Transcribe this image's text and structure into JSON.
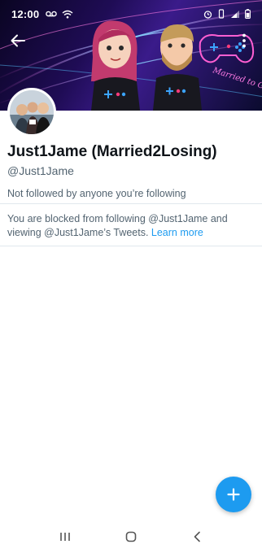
{
  "status_bar": {
    "time": "12:00",
    "left_icons": [
      "voicemail-icon",
      "wifi-icon"
    ],
    "right_icons": [
      "alarm-icon",
      "vibrate-icon",
      "signal-icon",
      "battery-icon"
    ]
  },
  "header": {
    "back_icon": "arrow-left-icon",
    "more_icon": "more-vertical-icon",
    "banner_text": "Married to Gaming"
  },
  "profile": {
    "display_name": "Just1Jame (Married2Losing)",
    "handle": "@Just1Jame",
    "followers_note": "Not followed by anyone you’re following"
  },
  "blocked_notice": {
    "text": "You are blocked from following @Just1Jame and viewing @Just1Jame’s Tweets. ",
    "link_label": "Learn more"
  },
  "fab": {
    "icon": "plus-icon"
  },
  "nav_bar": {
    "icons": [
      "recent-apps-icon",
      "home-icon",
      "back-icon"
    ]
  },
  "colors": {
    "accent": "#1d9bf0",
    "text_primary": "#0f1419",
    "text_secondary": "#536471",
    "divider": "#e1e8ed"
  }
}
